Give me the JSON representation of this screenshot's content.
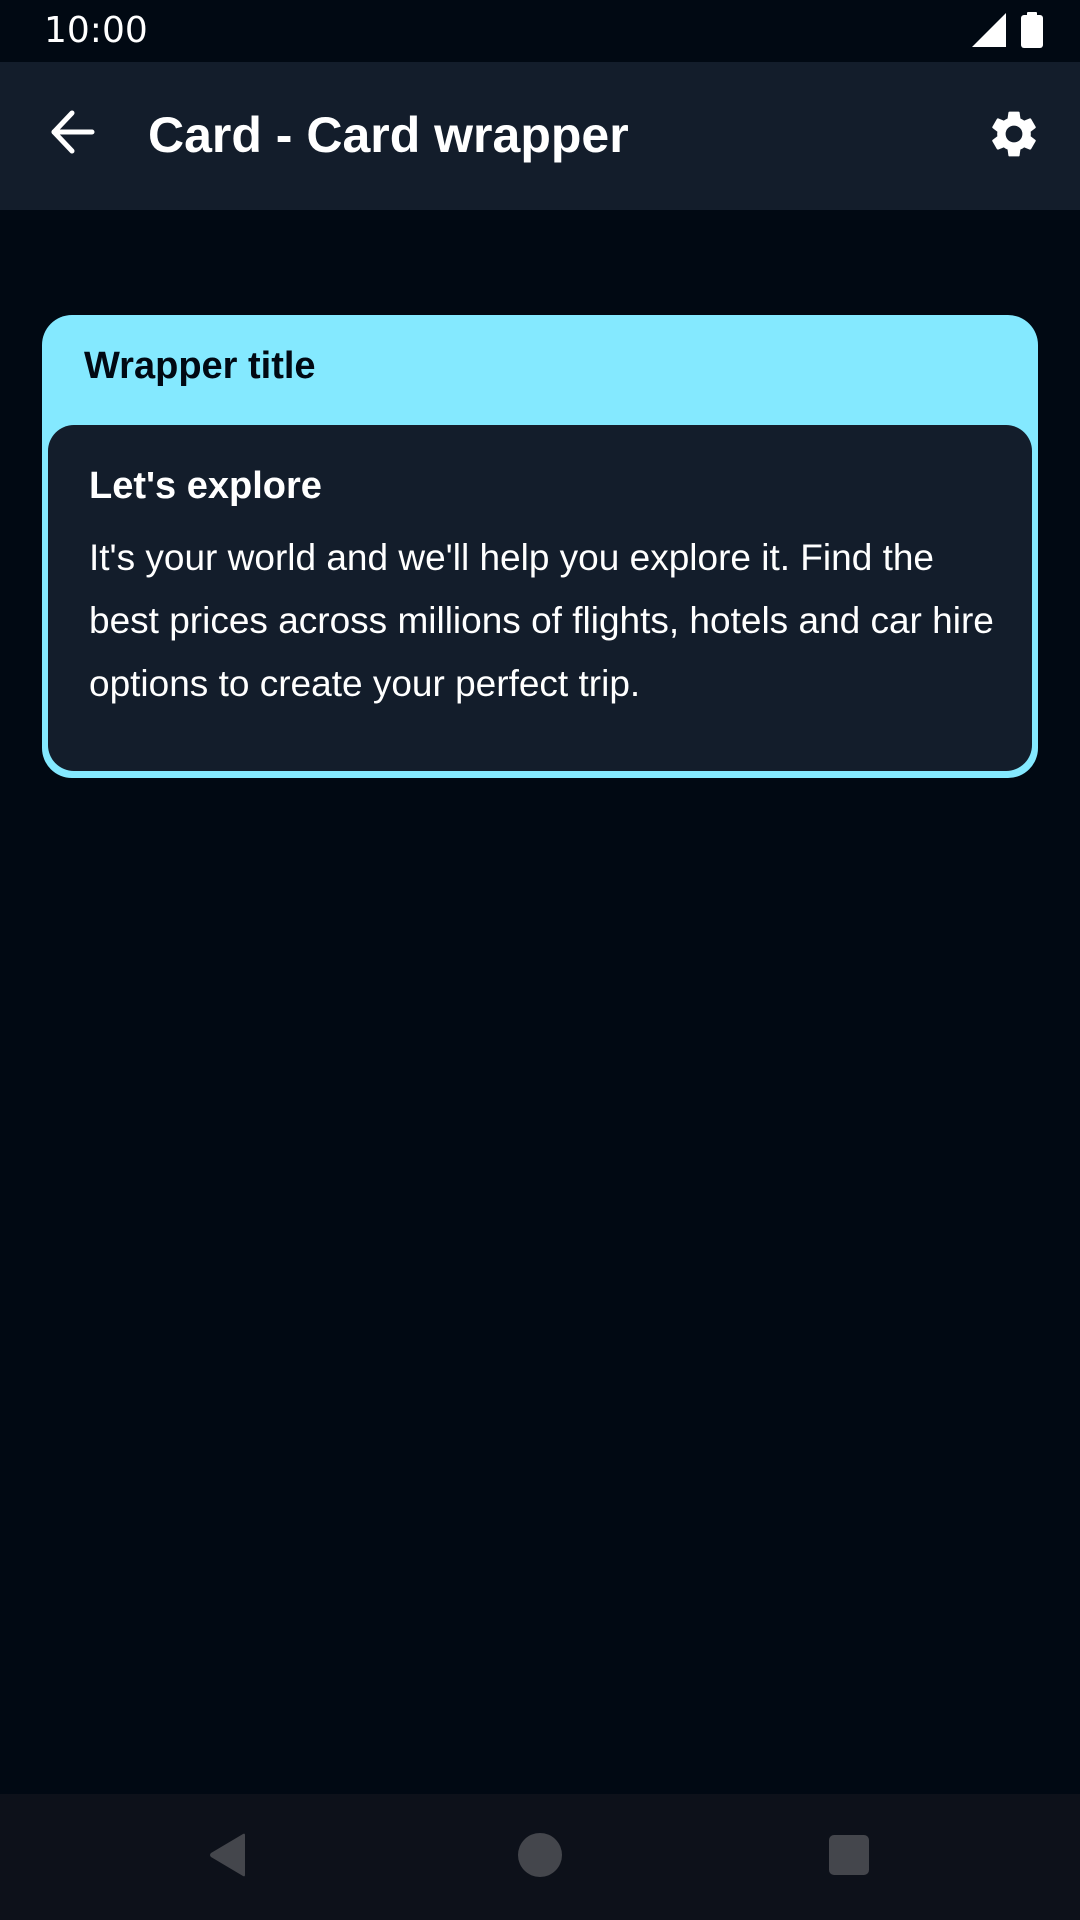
{
  "status_bar": {
    "time": "10:00",
    "icons": [
      "signal-icon",
      "battery-icon"
    ]
  },
  "app_bar": {
    "title": "Card - Card wrapper",
    "back_icon": "arrow-back-icon",
    "settings_icon": "gear-icon"
  },
  "wrapper_card": {
    "title": "Wrapper title",
    "content": {
      "heading": "Let's explore",
      "body": "It's your world and we'll help you explore it. Find the best prices across millions of flights, hotels and car hire options to create your perfect trip."
    }
  },
  "nav_bar": {
    "buttons": [
      "nav-back-icon",
      "nav-home-icon",
      "nav-recents-icon"
    ]
  },
  "colors": {
    "background": "#010913",
    "app_bar": "#131d2b",
    "wrapper_accent": "#84e9ff",
    "card_surface": "#131d2b",
    "nav_bar": "#0d111a",
    "nav_icon": "#44464c"
  }
}
